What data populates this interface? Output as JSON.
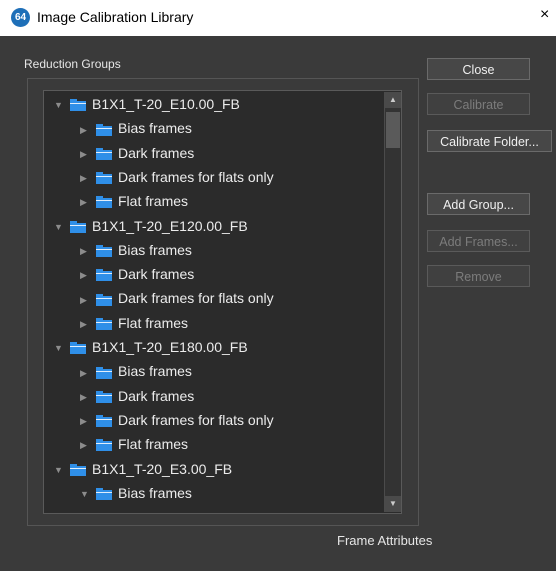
{
  "window": {
    "title": "Image Calibration Library",
    "icon_label": "64",
    "close_glyph": "×"
  },
  "reduction_groups": {
    "label": "Reduction Groups",
    "rows": [
      {
        "label": "B1X1_T-20_E10.00_FB",
        "level": 0,
        "expanded": true
      },
      {
        "label": "Bias frames",
        "level": 1,
        "expanded": false
      },
      {
        "label": "Dark frames",
        "level": 1,
        "expanded": false
      },
      {
        "label": "Dark frames for flats only",
        "level": 1,
        "expanded": false
      },
      {
        "label": "Flat frames",
        "level": 1,
        "expanded": false
      },
      {
        "label": "B1X1_T-20_E120.00_FB",
        "level": 0,
        "expanded": true
      },
      {
        "label": "Bias frames",
        "level": 1,
        "expanded": false
      },
      {
        "label": "Dark frames",
        "level": 1,
        "expanded": false
      },
      {
        "label": "Dark frames for flats only",
        "level": 1,
        "expanded": false
      },
      {
        "label": "Flat frames",
        "level": 1,
        "expanded": false
      },
      {
        "label": "B1X1_T-20_E180.00_FB",
        "level": 0,
        "expanded": true
      },
      {
        "label": "Bias frames",
        "level": 1,
        "expanded": false
      },
      {
        "label": "Dark frames",
        "level": 1,
        "expanded": false
      },
      {
        "label": "Dark frames for flats only",
        "level": 1,
        "expanded": false
      },
      {
        "label": "Flat frames",
        "level": 1,
        "expanded": false
      },
      {
        "label": "B1X1_T-20_E3.00_FB",
        "level": 0,
        "expanded": true
      },
      {
        "label": "Bias frames",
        "level": 1,
        "expanded": true
      }
    ]
  },
  "buttons": {
    "close": "Close",
    "calibrate": "Calibrate",
    "calibrate_folder": "Calibrate Folder...",
    "add_group": "Add Group...",
    "add_frames": "Add Frames...",
    "remove": "Remove"
  },
  "frame_attributes": {
    "label": "Frame Attributes"
  },
  "colors": {
    "background": "#3a3a3a",
    "tree_background": "#2b2b2b",
    "folder_blue": "#2f8fe8",
    "text": "#ececec",
    "disabled_text": "#7c7c7c"
  }
}
